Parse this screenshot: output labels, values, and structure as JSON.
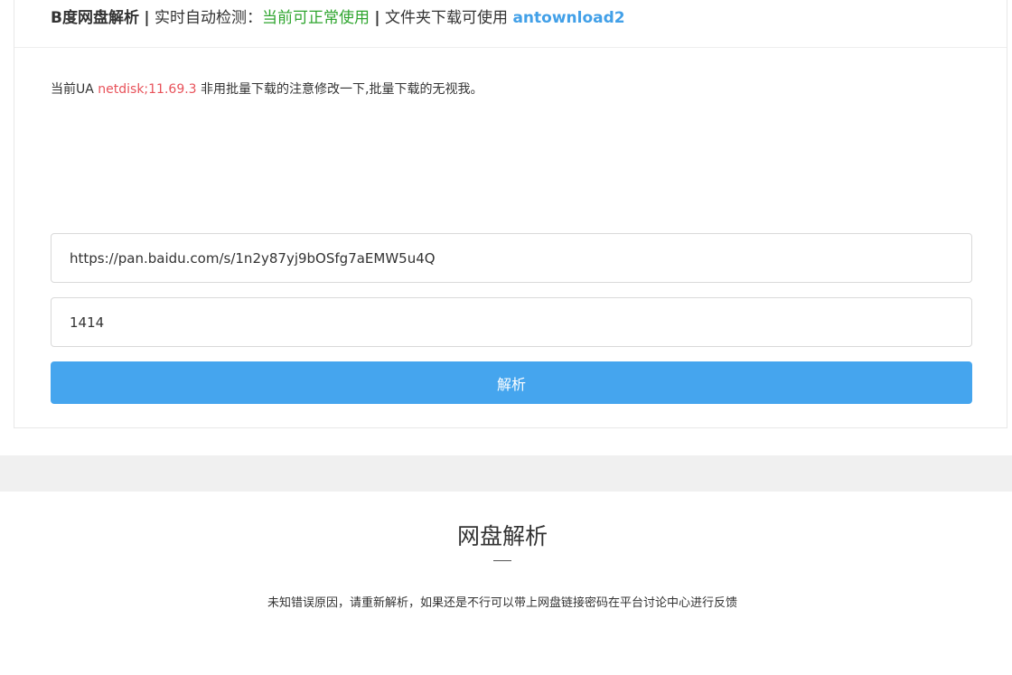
{
  "header": {
    "title": "B度网盘解析",
    "separator": "|",
    "detect_label": "实时自动检测：",
    "status_text": "当前可正常使用",
    "folder_label": "文件夹下载可使用",
    "folder_link": "antownload2"
  },
  "notice": {
    "prefix": "当前UA",
    "ua_value": "netdisk;11.69.3",
    "suffix": "非用批量下载的注意修改一下,批量下载的无视我。"
  },
  "form": {
    "url_value": "https://pan.baidu.com/s/1n2y87yj9bOSfg7aEMW5u4Q",
    "password_value": "1414",
    "submit_label": "解析"
  },
  "footer": {
    "title": "网盘解析",
    "message": "未知错误原因，请重新解析，如果还是不行可以带上网盘链接密码在平台讨论中心进行反馈"
  },
  "colors": {
    "status": "#2fa52f",
    "link": "#42a0e8",
    "ua": "#e8525a",
    "button": "#45a5ee",
    "band": "#f0f0f0"
  }
}
